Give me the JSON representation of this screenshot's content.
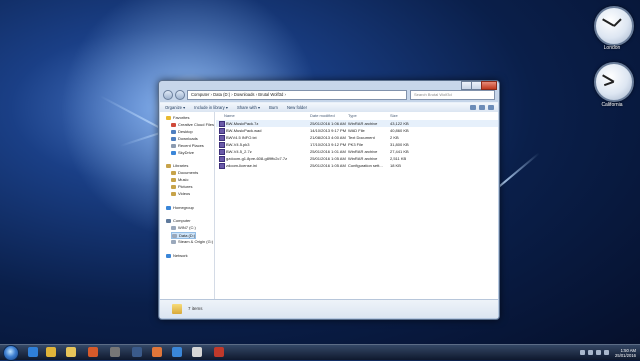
{
  "gadgets": [
    {
      "name": "clock-london",
      "label": "London"
    },
    {
      "name": "clock-california",
      "label": "California"
    }
  ],
  "window": {
    "address": "Computer › Data (D:) › Downloads › Brutal Wolf3d ›",
    "search_placeholder": "Search Brutal Wolf3d",
    "commands": [
      "Organize ▾",
      "Include in library ▾",
      "Share with ▾",
      "Burn",
      "New folder"
    ],
    "columns": {
      "name": "Name",
      "date": "Date modified",
      "type": "Type",
      "size": "Size"
    },
    "files": [
      {
        "name": "BW-MusicPack.7z",
        "date": "25/01/2016 1:06 AM",
        "type": "WinRAR archive",
        "size": "43,122 KB",
        "selected": true
      },
      {
        "name": "BW-MusicPack.wad",
        "date": "14/10/2013 9:17 PM",
        "type": "WAD File",
        "size": "40,860 KB",
        "selected": false
      },
      {
        "name": "BWV4.5 INFO.txt",
        "date": "21/08/2013 4:00 AM",
        "type": "Text Document",
        "size": "2 KB",
        "selected": false
      },
      {
        "name": "BW-V4.5.pk3",
        "date": "17/10/2013 9:12 PM",
        "type": "PK3 File",
        "size": "31,800 KB",
        "selected": false
      },
      {
        "name": "BW-V4.5_2.7z",
        "date": "25/01/2016 1:01 AM",
        "type": "WinRAR archive",
        "size": "27,441 KB",
        "selected": false
      },
      {
        "name": "gzdoom-g1.8pre-608-g89ffc2c7.7z",
        "date": "25/01/2016 1:05 AM",
        "type": "WinRAR archive",
        "size": "2,511 KB",
        "selected": false
      },
      {
        "name": "zdoom-license.ini",
        "date": "25/01/2016 1:05 AM",
        "type": "Configuration sett...",
        "size": "18 KB",
        "selected": false
      }
    ],
    "nav": [
      {
        "label": "Favorites",
        "color": "#e8b931"
      },
      {
        "label": "Creative Cloud Files",
        "color": "#d04a3a"
      },
      {
        "label": "Desktop",
        "color": "#4f7fc0"
      },
      {
        "label": "Downloads",
        "color": "#4f7fc0"
      },
      {
        "label": "Recent Places",
        "color": "#8c9bb0"
      },
      {
        "label": "SkyDrive",
        "color": "#3a86d8"
      },
      {
        "label": "Libraries",
        "color": "#c7a34a"
      },
      {
        "label": "Documents",
        "color": "#c7a34a"
      },
      {
        "label": "Music",
        "color": "#c7a34a"
      },
      {
        "label": "Pictures",
        "color": "#c7a34a"
      },
      {
        "label": "Videos",
        "color": "#c7a34a"
      },
      {
        "label": "Homegroup",
        "color": "#3a86d8"
      },
      {
        "label": "Computer",
        "color": "#5f7a9c"
      },
      {
        "label": "WIN7 (C:)",
        "color": "#9aa8bb"
      },
      {
        "label": "Data (D:)",
        "color": "#9aa8bb"
      },
      {
        "label": "Steam & Origin (G:)",
        "color": "#9aa8bb"
      },
      {
        "label": "Network",
        "color": "#3a86d8"
      }
    ],
    "item_count": "7 items"
  },
  "taskbar": {
    "icons": [
      {
        "name": "ie-icon",
        "color": "#2f7fd8"
      },
      {
        "name": "chrome-icon",
        "color": "#e0b43a"
      },
      {
        "name": "explorer-icon",
        "color": "#e6c45a"
      },
      {
        "name": "media-icon",
        "color": "#d65a2a"
      },
      {
        "name": "app-icon",
        "color": "#777777"
      },
      {
        "name": "steam-icon",
        "color": "#3a5a8a"
      },
      {
        "name": "firefox-icon",
        "color": "#e0763a"
      },
      {
        "name": "app2-icon",
        "color": "#3a86d8"
      },
      {
        "name": "app3-icon",
        "color": "#d6d6d6"
      },
      {
        "name": "app4-icon",
        "color": "#c0392b"
      }
    ],
    "time": "1:50 AM",
    "date": "25/01/2016"
  }
}
